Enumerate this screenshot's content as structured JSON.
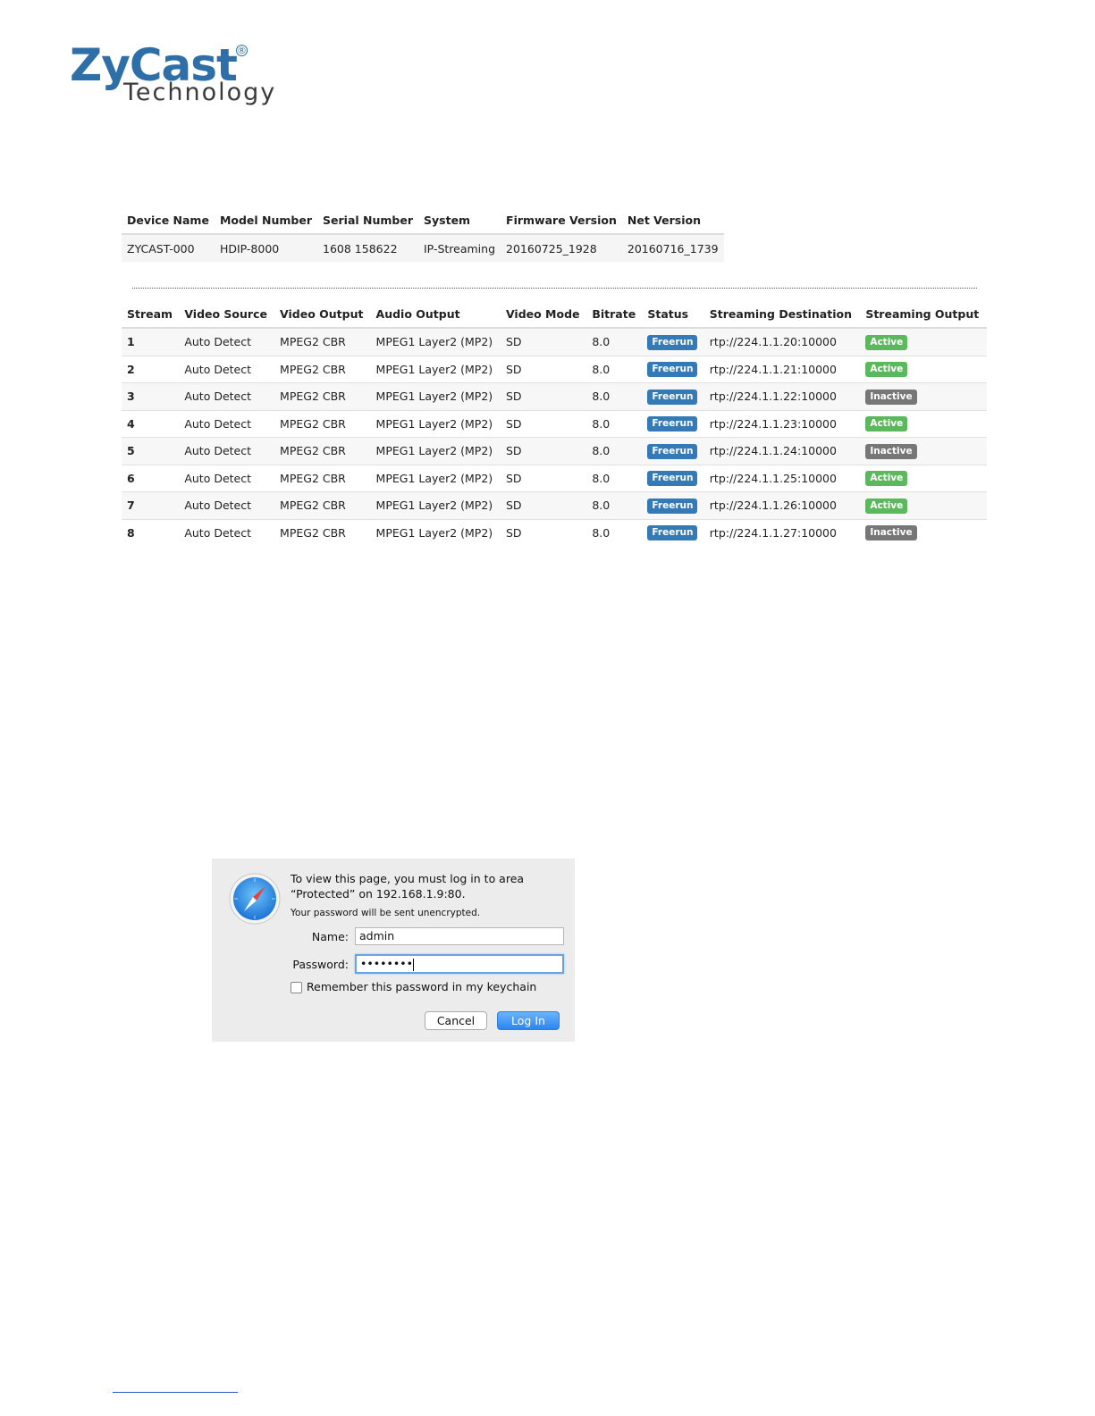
{
  "logo": {
    "main": "ZyCast",
    "registered": "®",
    "sub": "Technology"
  },
  "device_table": {
    "headers": [
      "Device Name",
      "Model Number",
      "Serial Number",
      "System",
      "Firmware Version",
      "Net Version"
    ],
    "row": [
      "ZYCAST-000",
      "HDIP-8000",
      "1608 158622",
      "IP-Streaming",
      "20160725_1928",
      "20160716_1739"
    ]
  },
  "stream_table": {
    "headers": [
      "Stream",
      "Video Source",
      "Video Output",
      "Audio Output",
      "Video Mode",
      "Bitrate",
      "Status",
      "Streaming Destination",
      "Streaming Output"
    ],
    "rows": [
      {
        "stream": "1",
        "source": "Auto Detect",
        "video": "MPEG2 CBR",
        "audio": "MPEG1 Layer2 (MP2)",
        "mode": "SD",
        "bitrate": "8.0",
        "status": "Freerun",
        "dest": "rtp://224.1.1.20:10000",
        "output": "Active"
      },
      {
        "stream": "2",
        "source": "Auto Detect",
        "video": "MPEG2 CBR",
        "audio": "MPEG1 Layer2 (MP2)",
        "mode": "SD",
        "bitrate": "8.0",
        "status": "Freerun",
        "dest": "rtp://224.1.1.21:10000",
        "output": "Active"
      },
      {
        "stream": "3",
        "source": "Auto Detect",
        "video": "MPEG2 CBR",
        "audio": "MPEG1 Layer2 (MP2)",
        "mode": "SD",
        "bitrate": "8.0",
        "status": "Freerun",
        "dest": "rtp://224.1.1.22:10000",
        "output": "Inactive"
      },
      {
        "stream": "4",
        "source": "Auto Detect",
        "video": "MPEG2 CBR",
        "audio": "MPEG1 Layer2 (MP2)",
        "mode": "SD",
        "bitrate": "8.0",
        "status": "Freerun",
        "dest": "rtp://224.1.1.23:10000",
        "output": "Active"
      },
      {
        "stream": "5",
        "source": "Auto Detect",
        "video": "MPEG2 CBR",
        "audio": "MPEG1 Layer2 (MP2)",
        "mode": "SD",
        "bitrate": "8.0",
        "status": "Freerun",
        "dest": "rtp://224.1.1.24:10000",
        "output": "Inactive"
      },
      {
        "stream": "6",
        "source": "Auto Detect",
        "video": "MPEG2 CBR",
        "audio": "MPEG1 Layer2 (MP2)",
        "mode": "SD",
        "bitrate": "8.0",
        "status": "Freerun",
        "dest": "rtp://224.1.1.25:10000",
        "output": "Active"
      },
      {
        "stream": "7",
        "source": "Auto Detect",
        "video": "MPEG2 CBR",
        "audio": "MPEG1 Layer2 (MP2)",
        "mode": "SD",
        "bitrate": "8.0",
        "status": "Freerun",
        "dest": "rtp://224.1.1.26:10000",
        "output": "Active"
      },
      {
        "stream": "8",
        "source": "Auto Detect",
        "video": "MPEG2 CBR",
        "audio": "MPEG1 Layer2 (MP2)",
        "mode": "SD",
        "bitrate": "8.0",
        "status": "Freerun",
        "dest": "rtp://224.1.1.27:10000",
        "output": "Inactive"
      }
    ]
  },
  "colors": {
    "brand": "#2f6fa7",
    "status_blue": "#337ab7",
    "active_green": "#5cb85c",
    "inactive_gray": "#777777"
  },
  "login_dialog": {
    "icon": "safari-compass-icon",
    "message_line1": "To view this page, you must log in to area",
    "message_line2": "“Protected” on 192.168.1.9:80.",
    "warning": "Your password will be sent unencrypted.",
    "name_label": "Name:",
    "name_value": "admin",
    "password_label": "Password:",
    "password_value": "••••••••",
    "remember_label": "Remember this password in my keychain",
    "cancel_label": "Cancel",
    "login_label": "Log In"
  }
}
